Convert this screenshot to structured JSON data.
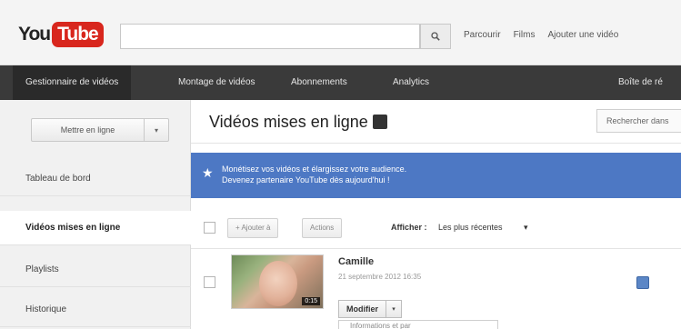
{
  "header": {
    "logo_you": "You",
    "logo_tube": "Tube",
    "search_placeholder": "",
    "links": [
      "Parcourir",
      "Films",
      "Ajouter une vidéo"
    ]
  },
  "nav": {
    "items": [
      "Gestionnaire de vidéos",
      "Montage de vidéos",
      "Abonnements",
      "Analytics"
    ],
    "right_label": "Boîte de ré"
  },
  "sidebar": {
    "upload_label": "Mettre en ligne",
    "items": [
      "Tableau de bord",
      "Vidéos mises en ligne",
      "Playlists",
      "Historique"
    ]
  },
  "main": {
    "title": "Vidéos mises en ligne",
    "search_placeholder": "Rechercher dans",
    "banner": {
      "line1": "Monétisez vos vidéos et élargissez votre audience.",
      "line2": "Devenez partenaire YouTube dès aujourd'hui !"
    },
    "toolbar": {
      "add_to": "+ Ajouter à",
      "actions": "Actions",
      "show_label": "Afficher :",
      "sort_value": "Les plus récentes"
    },
    "video": {
      "title": "Camille",
      "date": "21 septembre 2012 16:35",
      "duration": "0:15",
      "modify_label": "Modifier",
      "dropdown_partial": "Informations et par"
    }
  }
}
